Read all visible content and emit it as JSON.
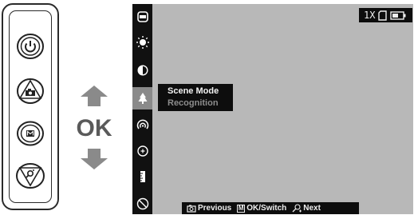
{
  "nav": {
    "ok_label": "OK"
  },
  "remote": {
    "buttons": [
      {
        "name": "power-button",
        "icon": "power-icon"
      },
      {
        "name": "camera-button",
        "icon": "camera-icon"
      },
      {
        "name": "menu-button",
        "icon": "m-icon"
      },
      {
        "name": "zoom-button",
        "icon": "zoom-icon"
      }
    ]
  },
  "screen": {
    "status": {
      "zoom": "1X",
      "icons": [
        "sd-card-icon",
        "battery-icon"
      ]
    },
    "sidebar": {
      "items": [
        {
          "icon": "rectangle-icon"
        },
        {
          "icon": "brightness-icon"
        },
        {
          "icon": "contrast-icon"
        },
        {
          "icon": "tree-icon",
          "active": true
        },
        {
          "icon": "signal-icon"
        },
        {
          "icon": "crosshair-icon"
        },
        {
          "icon": "ruler-icon"
        },
        {
          "icon": "compass-icon"
        }
      ]
    },
    "popup": {
      "title": "Scene Mode",
      "subtitle": "Recognition"
    },
    "hint_bar": {
      "previous_label": "Previous",
      "ok_label": "OK/Switch",
      "next_label": "Next",
      "m_key": "M"
    }
  },
  "colors": {
    "screen_bg": "#b8b8b8",
    "sidebar_bg": "#111111",
    "active_item_bg": "#8a8a8a",
    "arrow": "#8a8a8a",
    "ok_text": "#5a5a5a"
  }
}
